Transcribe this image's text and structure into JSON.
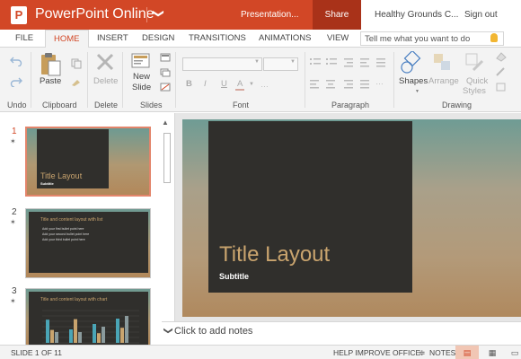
{
  "titlebar": {
    "logo_letter": "P",
    "app_name": "PowerPoint Online",
    "chevron": "❯",
    "doc_name": "Presentation...",
    "share_label": "Share",
    "account_name": "Healthy Grounds C...",
    "signout_label": "Sign out"
  },
  "tabs": [
    {
      "label": "FILE"
    },
    {
      "label": "HOME"
    },
    {
      "label": "INSERT"
    },
    {
      "label": "DESIGN"
    },
    {
      "label": "TRANSITIONS"
    },
    {
      "label": "ANIMATIONS"
    },
    {
      "label": "VIEW"
    }
  ],
  "tellme_placeholder": "Tell me what you want to do",
  "ribbon": {
    "undo_label": "Undo",
    "clipboard_label": "Clipboard",
    "paste_label": "Paste",
    "delete_group_label": "Delete",
    "delete_label": "Delete",
    "slides_label": "Slides",
    "new_slide_label_1": "New",
    "new_slide_label_2": "Slide",
    "font_label": "Font",
    "paragraph_label": "Paragraph",
    "drawing_label": "Drawing",
    "shapes_label": "Shapes",
    "arrange_label": "Arrange",
    "quick_styles_label_1": "Quick",
    "quick_styles_label_2": "Styles",
    "bold": "B",
    "italic": "I",
    "underline": "U",
    "font_color": "A"
  },
  "thumbnails": [
    {
      "number": "1",
      "title": "Title Layout",
      "subtitle": "Subtitle"
    },
    {
      "number": "2",
      "title": "Title and content layout with list",
      "bullets": [
        "Add your first bullet point here",
        "Add your second bullet point here",
        "Add your third bullet point here"
      ]
    },
    {
      "number": "3",
      "title": "Title and content layout with chart"
    }
  ],
  "thumb_chart": {
    "type": "bar",
    "series": [
      {
        "values": [
          4.3,
          2.5,
          3.5,
          4.5
        ],
        "color": "#4aa5b6"
      },
      {
        "values": [
          2.4,
          4.4,
          1.8,
          2.8
        ],
        "color": "#c9a46e"
      },
      {
        "values": [
          2.0,
          2.0,
          3.0,
          5.0
        ],
        "color": "#8a9a9c"
      }
    ],
    "ylim": [
      0,
      6
    ]
  },
  "main_slide": {
    "title": "Title Layout",
    "subtitle": "Subtitle"
  },
  "notes_placeholder": "Click to add notes",
  "notes_chevron": "❯",
  "status": {
    "slide_count": "SLIDE 1 OF 11",
    "help": "HELP IMPROVE OFFICE",
    "notes": "NOTES"
  }
}
